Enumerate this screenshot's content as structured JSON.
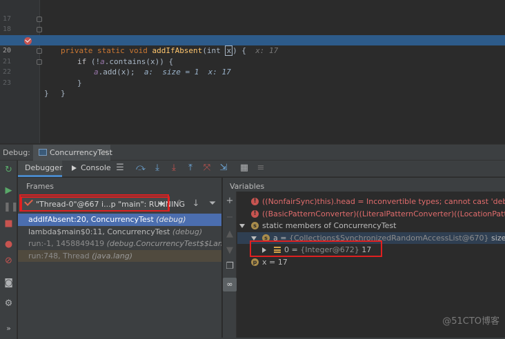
{
  "editor": {
    "lines": [
      {
        "num": "17",
        "html_parts": []
      },
      {
        "num": "18",
        "kw": "private static void ",
        "fn": "addIfAbsent",
        "rest1": "(int ",
        "param": "x",
        "rest2": ") {",
        "hint": "x: 17"
      },
      {
        "num": "19",
        "code_a": "if (!",
        "field": "a",
        "code_b": ".contains(x)) {"
      },
      {
        "num": "20",
        "field": "a",
        "code": ".add(x);",
        "hint": "a:  size = 1  x: 17"
      },
      {
        "num": "21",
        "code": "}"
      },
      {
        "num": "22",
        "code": "}"
      },
      {
        "num": "23",
        "code": "}"
      }
    ]
  },
  "debug_header": {
    "label": "Debug:",
    "run_tab": "ConcurrencyTest",
    "close": "×"
  },
  "tabs": {
    "debugger": "Debugger",
    "console": "Console"
  },
  "frames": {
    "title": "Frames",
    "thread": "\"Thread-0\"@667 i...p \"main\": RUNNING",
    "rows": [
      {
        "method": "addIfAbsent:20, ConcurrencyTest ",
        "loc": "(debug)"
      },
      {
        "method": "lambda$main$0:11, ConcurrencyTest ",
        "loc": "(debug)"
      },
      {
        "method": "run:-1, 1458849419 ",
        "loc": "(debug.ConcurrencyTest$$Lambda$1)"
      },
      {
        "method": "run:748, Thread ",
        "loc": "(java.lang)"
      }
    ]
  },
  "variables": {
    "title": "Variables",
    "error1": "((NonfairSync)this).head = Inconvertible types; cannot cast 'debug.ConcurrencyTes",
    "error2": "((BasicPatternConverter)((LiteralPatternConverter)((LocationPatternConverter)((Litera",
    "static_row": "static members of ConcurrencyTest",
    "a_name": "a = ",
    "a_value": "{Collections$SynchronizedRandomAccessList@670}",
    "a_size": "  size = 1",
    "item_name": "0 = ",
    "item_value": "{Integer@672}",
    "item_num": " 17",
    "x_row": "x = 17"
  },
  "icons": {
    "error": "!",
    "static": "s",
    "param": "p"
  },
  "watermark": "@51CTO博客",
  "colors": {
    "accent": "#4a88c7",
    "selection": "#4b6eaf",
    "current_line": "#2d5b8a",
    "highlight_box": "#e02020"
  }
}
